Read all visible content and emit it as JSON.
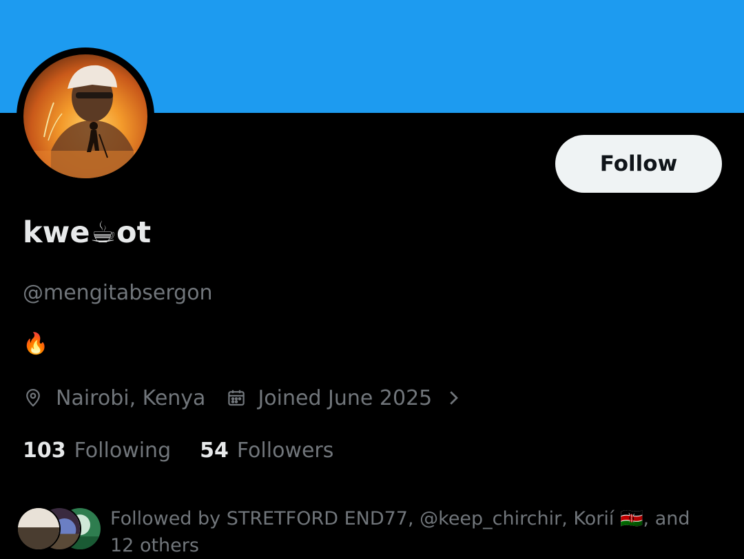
{
  "colors": {
    "banner": "#1d9bf0",
    "background": "#000000",
    "text_primary": "#e7e9ea",
    "text_secondary": "#71767b",
    "follow_button_bg": "#eff3f4",
    "follow_button_text": "#0f1419"
  },
  "profile": {
    "display_name": "kwe☕ot",
    "handle": "@mengitabsergon",
    "bio": "🔥",
    "location": "Nairobi, Kenya",
    "joined": "Joined June 2025",
    "location_icon": "map-pin-icon",
    "joined_icon": "calendar-icon"
  },
  "actions": {
    "follow_label": "Follow"
  },
  "stats": {
    "following_count": "103",
    "following_label": "Following",
    "followers_count": "54",
    "followers_label": "Followers"
  },
  "followed_by": {
    "text": "Followed by STRETFORD END77, @keep_chirchir, Korií 🇰🇪, and 12 others"
  }
}
